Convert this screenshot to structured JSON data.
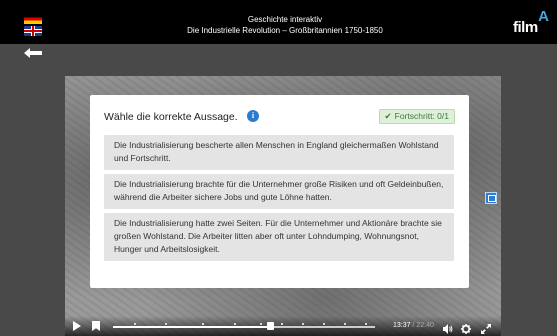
{
  "header": {
    "title_line1": "Geschichte interaktiv",
    "title_line2": "Die Industrielle Revolution – Großbritannien 1750-1850",
    "brand": "film"
  },
  "languages": [
    "de",
    "en"
  ],
  "quiz": {
    "question": "Wähle die korrekte Aussage.",
    "progress_label": "Fortschritt: 0/1",
    "options": [
      "Die Industrialisierung bescherte allen Menschen in England gleichermaßen Wohlstand und Fortschritt.",
      "Die Industrialisierung brachte für die Unternehmer große Risiken und oft Geldeinbußen, während die Arbeiter sichere Jobs und gute Löhne hatten.",
      "Die Industrialisierung hatte zwei Seiten. Für die Unternehmer und Aktionäre brachte sie großen Wohlstand. Die Arbeiter litten aber oft unter Lohndumping, Wohnungsnot, Hunger und Arbeitslosigkeit."
    ]
  },
  "player": {
    "current_time": "13:37",
    "total_time": "22:40",
    "progress": 0.6,
    "chapter_markers": [
      0.08,
      0.2,
      0.34,
      0.46,
      0.56,
      0.64,
      0.72,
      0.8,
      0.88,
      0.96
    ]
  },
  "colors": {
    "accent": "#2a7ccc",
    "progress_bg": "#dff0d8",
    "progress_text": "#3c763d",
    "option_bg": "#e4e4e4"
  }
}
